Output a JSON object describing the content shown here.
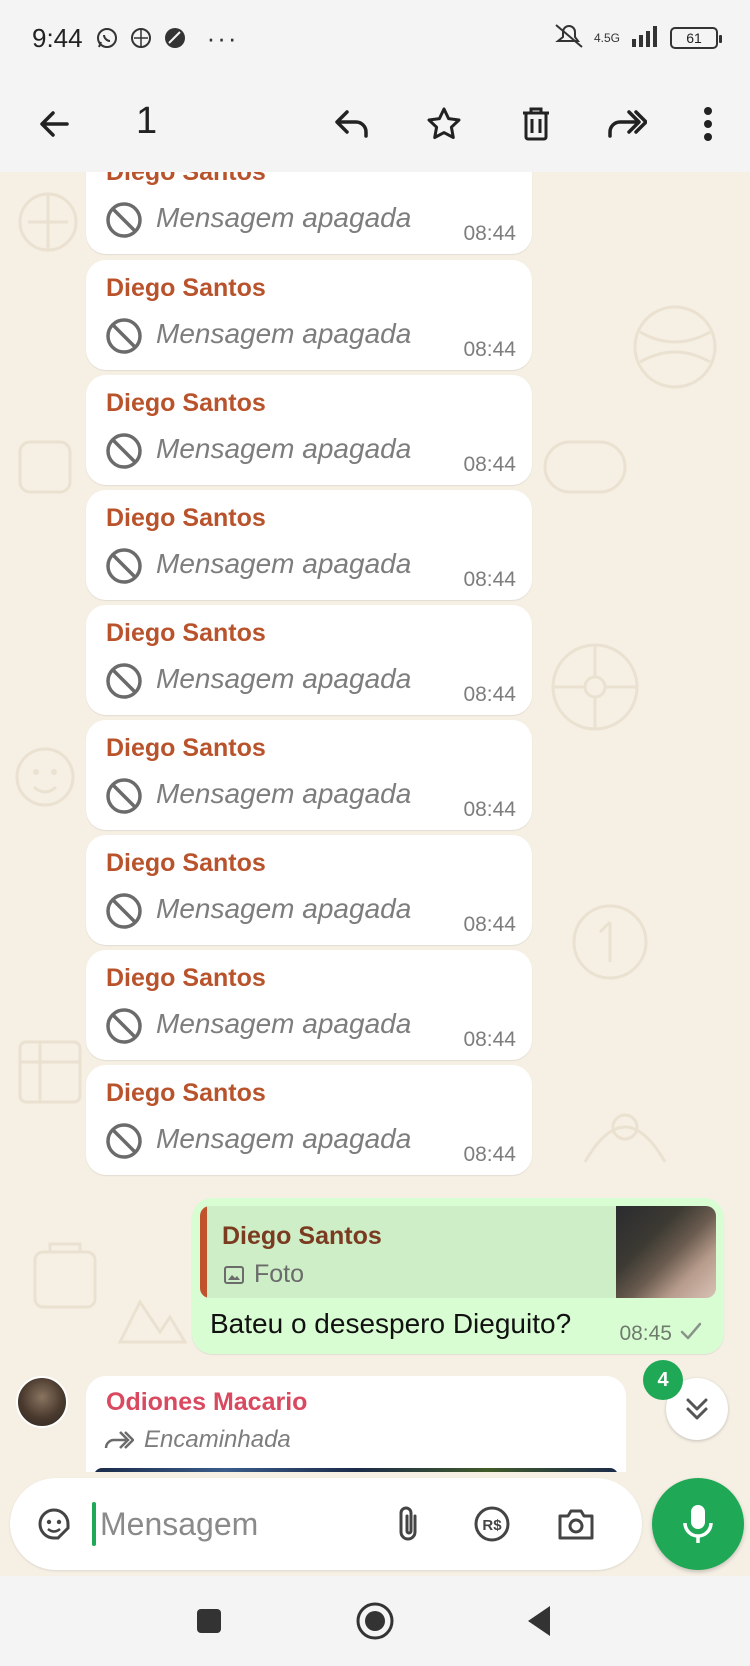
{
  "status_bar": {
    "time": "9:44",
    "icons": [
      "whatsapp-icon",
      "vpn-icon",
      "circle-icon"
    ],
    "more": "···",
    "network_label": "4.5G",
    "battery": "61"
  },
  "toolbar": {
    "selected_count": "1",
    "actions": [
      "back-icon",
      "reply-icon",
      "star-icon",
      "delete-icon",
      "forward-icon",
      "more-icon"
    ]
  },
  "messages": [
    {
      "sender": "Diego Santos",
      "text": "Mensagem apagada",
      "time": "08:44"
    },
    {
      "sender": "Diego Santos",
      "text": "Mensagem apagada",
      "time": "08:44"
    },
    {
      "sender": "Diego Santos",
      "text": "Mensagem apagada",
      "time": "08:44"
    },
    {
      "sender": "Diego Santos",
      "text": "Mensagem apagada",
      "time": "08:44"
    },
    {
      "sender": "Diego Santos",
      "text": "Mensagem apagada",
      "time": "08:44"
    },
    {
      "sender": "Diego Santos",
      "text": "Mensagem apagada",
      "time": "08:44"
    },
    {
      "sender": "Diego Santos",
      "text": "Mensagem apagada",
      "time": "08:44"
    },
    {
      "sender": "Diego Santos",
      "text": "Mensagem apagada",
      "time": "08:44"
    },
    {
      "sender": "Diego Santos",
      "text": "Mensagem apagada",
      "time": "08:44"
    }
  ],
  "outgoing": {
    "quote_sender": "Diego Santos",
    "quote_type": "Foto",
    "text": "Bateu o desespero Dieguito?",
    "time": "08:45"
  },
  "forwarded": {
    "sender": "Odiones Macario",
    "label": "Encaminhada"
  },
  "unread_badge": "4",
  "composer": {
    "placeholder": "Mensagem"
  },
  "colors": {
    "accent": "#1fa855",
    "sender_name": "#b9532c",
    "outgoing_bg": "#d9fdd3",
    "chat_bg": "#f5efe4"
  }
}
